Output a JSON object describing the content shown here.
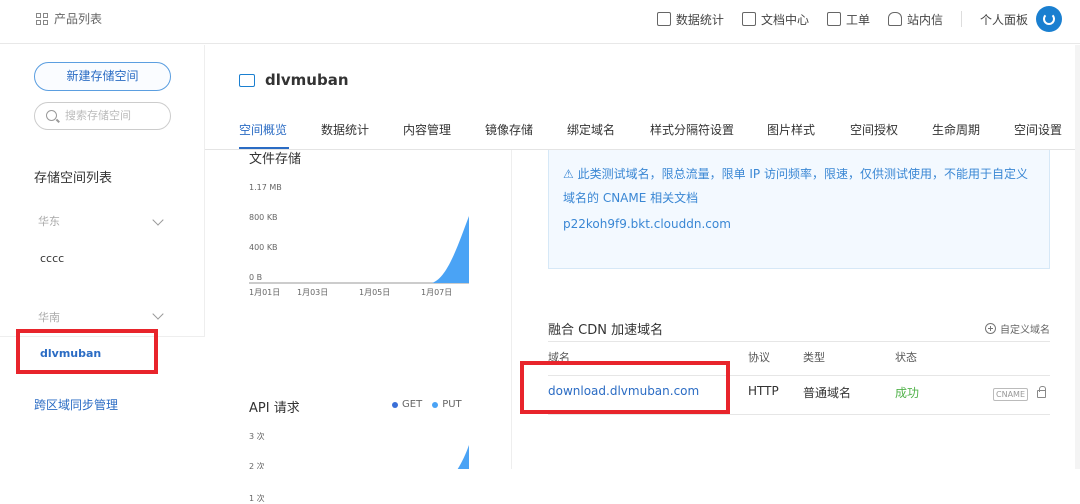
{
  "topbar": {
    "products_label": "产品列表",
    "nav": {
      "stats": "数据统计",
      "docs": "文档中心",
      "ticket": "工单",
      "inbox": "站内信",
      "personal": "个人面板"
    }
  },
  "sidebar": {
    "new_bucket_button": "新建存储空间",
    "search_placeholder": "搜索存储空间",
    "list_title": "存储空间列表",
    "regions": [
      {
        "name": "华东",
        "buckets": [
          "cccc"
        ]
      },
      {
        "name": "华南",
        "buckets": [
          "dlvmuban"
        ]
      }
    ],
    "cross_region_sync": "跨区域同步管理"
  },
  "main": {
    "bucket_name": "dlvmuban",
    "tabs": [
      "空间概览",
      "数据统计",
      "内容管理",
      "镜像存储",
      "绑定域名",
      "样式分隔符设置",
      "图片样式",
      "空间授权",
      "生命周期",
      "空间设置"
    ],
    "active_tab": "空间概览",
    "file_storage": {
      "title": "文件存储",
      "y_ticks": [
        "1.17 MB",
        "800 KB",
        "400 KB",
        "0 B"
      ],
      "x_ticks": [
        "1月01日",
        "1月03日",
        "1月05日",
        "1月07日"
      ]
    },
    "api_requests": {
      "title": "API 请求",
      "legend": [
        "GET",
        "PUT"
      ],
      "y_ticks": [
        "3 次",
        "2 次",
        "1 次"
      ]
    },
    "test_domain_notice": {
      "warning": "此类测试域名，限总流量，限单 IP 访问频率，限速，仅供测试使用，不能用于自定义域名的 CNAME 相关文档",
      "domain": "p22koh9f9.bkt.clouddn.com"
    },
    "cdn": {
      "title": "融合 CDN 加速域名",
      "custom_domain": "自定义域名",
      "columns": [
        "域名",
        "协议",
        "类型",
        "状态"
      ],
      "rows": [
        {
          "domain": "download.dlvmuban.com",
          "protocol": "HTTP",
          "type": "普通域名",
          "status": "成功",
          "badge": "CNAME"
        }
      ]
    }
  },
  "colors": {
    "accent": "#2b6cc4",
    "chart_fill": "#4aa3f5",
    "success": "#52b34b",
    "highlight": "#e8242b"
  },
  "chart_data": [
    {
      "type": "area",
      "title": "文件存储",
      "x": [
        "1月01日",
        "1月03日",
        "1月05日",
        "1月07日"
      ],
      "series": [
        {
          "values": [
            0,
            0,
            0,
            0,
            0,
            0,
            0.05,
            1.17
          ]
        }
      ],
      "ylabel_ticks": [
        "0 B",
        "400 KB",
        "800 KB",
        "1.17 MB"
      ]
    },
    {
      "type": "area",
      "title": "API 请求",
      "series": [
        {
          "name": "GET",
          "values": [
            0,
            0,
            0,
            0,
            0,
            0,
            0.2,
            1.3
          ]
        },
        {
          "name": "PUT",
          "values": []
        }
      ],
      "ylabel_ticks": [
        "1 次",
        "2 次",
        "3 次"
      ]
    }
  ]
}
